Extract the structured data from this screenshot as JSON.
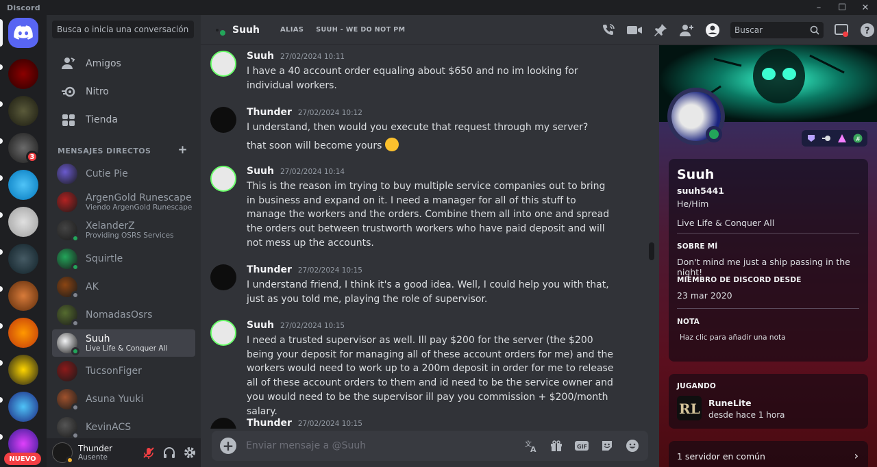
{
  "app": {
    "title": "Discord"
  },
  "window_controls": {
    "minimize": "–",
    "maximize": "☐",
    "close": "✕"
  },
  "rail": {
    "nuevo_label": "NUEVO",
    "badge_count": "3"
  },
  "sidebar": {
    "search_placeholder": "Busca o inicia una conversación",
    "nav": [
      {
        "label": "Amigos",
        "icon": "friends-icon"
      },
      {
        "label": "Nitro",
        "icon": "nitro-icon"
      },
      {
        "label": "Tienda",
        "icon": "shop-icon"
      }
    ],
    "dm_header": "MENSAJES DIRECTOS",
    "dm_add": "+",
    "dms": [
      {
        "name": "Cutie Pie",
        "sub": "",
        "status": "none",
        "color": "#6a5acd"
      },
      {
        "name": "ArgenGold Runescape",
        "sub": "Viendo ArgenGold Runescape",
        "status": "none",
        "color": "#b22222"
      },
      {
        "name": "XelanderZ",
        "sub": "Providing OSRS Services",
        "status": "on",
        "color": "#444444"
      },
      {
        "name": "Squirtle",
        "sub": "",
        "status": "on",
        "color": "#23a55a"
      },
      {
        "name": "AK",
        "sub": "",
        "status": "off",
        "color": "#8b4513"
      },
      {
        "name": "NomadasOsrs",
        "sub": "",
        "status": "off",
        "color": "#556b2f"
      },
      {
        "name": "Suuh",
        "sub": "Live Life & Conquer All",
        "status": "on",
        "color": "#f2f3f5"
      },
      {
        "name": "TucsonFiger",
        "sub": "",
        "status": "none",
        "color": "#8b1a1a"
      },
      {
        "name": "Asuna Yuuki",
        "sub": "",
        "status": "off",
        "color": "#a0522d"
      },
      {
        "name": "KevinACS",
        "sub": "",
        "status": "off",
        "color": "#555555"
      }
    ],
    "user": {
      "name": "Thunder",
      "status": "Ausente"
    }
  },
  "chat": {
    "recipient": "Suuh",
    "alias_label": "ALIAS",
    "alias_value": "SUUH - WE DO NOT PM",
    "composer_placeholder": "Enviar mensaje a @Suuh",
    "messages": [
      {
        "author": "Suuh",
        "time": "27/02/2024 10:11",
        "lines": [
          "I have a 40 account order equaling about $650 and no im looking for individual workers."
        ]
      },
      {
        "author": "Thunder",
        "time": "27/02/2024 10:12",
        "lines": [
          "I understand, then would you execute that request through my server?",
          "that soon will become yours"
        ]
      },
      {
        "author": "Suuh",
        "time": "27/02/2024 10:14",
        "lines": [
          "This is the reason im trying to buy multiple service companies out to bring in business and expand on it. I need a manager for all of this stuff to manage the workers and the orders. Combine them all into one and spread the orders out between trustworth workers who have paid deposit and will not mess up the accounts."
        ]
      },
      {
        "author": "Thunder",
        "time": "27/02/2024 10:15",
        "lines": [
          "I understand friend, I think it's a good idea. Well, I could help you with that, just as you told me, playing the role of supervisor."
        ]
      },
      {
        "author": "Suuh",
        "time": "27/02/2024 10:15",
        "lines": [
          "I need a trusted supervisor as well. Ill pay $200 for the server (the $200 being your deposit for managing all of these account orders for me) and the workers would need to work up to a 200m deposit in order for me to release all of these account orders to them and id need to be the service owner and you would need to be the supervisor ill pay you commission + $200/month salary."
        ]
      },
      {
        "author": "Thunder",
        "time": "27/02/2024 10:15",
        "lines": [
          ""
        ]
      }
    ]
  },
  "toolbar": {
    "search_placeholder": "Buscar"
  },
  "profile": {
    "display_name": "Suuh",
    "username": "suuh5441",
    "pronouns": "He/Him",
    "custom_status": "Live Life & Conquer All",
    "about_header": "SOBRE MÍ",
    "about_text": "Don't mind me just a ship passing in the night!",
    "member_header": "MIEMBRO DE DISCORD DESDE",
    "member_since": "23 mar 2020",
    "note_header": "NOTA",
    "note_placeholder": "Haz clic para añadir una nota",
    "playing_header": "JUGANDO",
    "game_name": "RuneLite",
    "game_time": "desde hace 1 hora",
    "mutual_servers": "1 servidor en común"
  },
  "colors": {
    "accent": "#5865f2",
    "online": "#23a55a",
    "danger": "#f23f43"
  }
}
